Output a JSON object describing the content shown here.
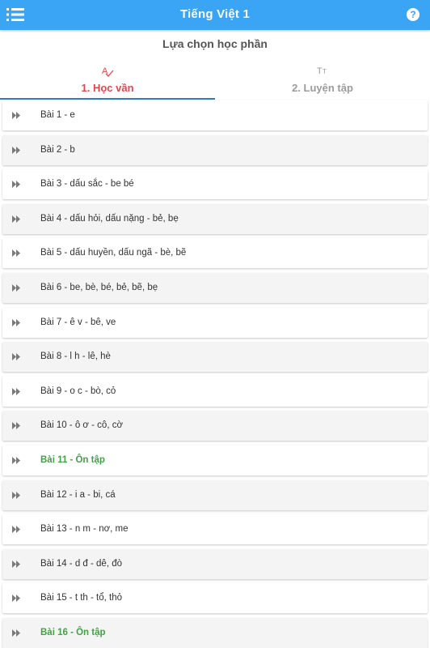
{
  "header": {
    "title": "Tiếng Việt 1",
    "help_label": "?"
  },
  "subtitle": "Lựa chọn học phần",
  "tabs": [
    {
      "label": "1. Học vần",
      "icon": "spell-check-icon",
      "active": true
    },
    {
      "label": "2. Luyện tập",
      "icon": "text-size-icon",
      "active": false
    }
  ],
  "lessons": [
    {
      "label": "Bài 1 - e",
      "review": false
    },
    {
      "label": "Bài 2 - b",
      "review": false
    },
    {
      "label": "Bài 3 - dấu sắc - be bé",
      "review": false
    },
    {
      "label": "Bài 4 - dấu hỏi, dấu nặng - bẻ, bẹ",
      "review": false
    },
    {
      "label": "Bài 5 - dấu huyền, dấu ngã - bè, bẽ",
      "review": false
    },
    {
      "label": "Bài 6 - be, bè, bé, bẻ, bẽ, bẹ",
      "review": false
    },
    {
      "label": "Bài 7 - ê v - bê, ve",
      "review": false
    },
    {
      "label": "Bài 8 - l h - lê, hè",
      "review": false
    },
    {
      "label": "Bài 9 - o c - bò, cỏ",
      "review": false
    },
    {
      "label": "Bài 10 - ô ơ - cô, cờ",
      "review": false
    },
    {
      "label": "Bài 11 - Ôn tập",
      "review": true
    },
    {
      "label": "Bài 12 - i a - bi, cá",
      "review": false
    },
    {
      "label": "Bài 13 - n m - nơ, me",
      "review": false
    },
    {
      "label": "Bài 14 - d đ - dê, đò",
      "review": false
    },
    {
      "label": "Bài 15 - t th - tổ, thỏ",
      "review": false
    },
    {
      "label": "Bài 16 - Ôn tập",
      "review": true
    }
  ],
  "colors": {
    "appbar": "#3aa4f5",
    "active_tab": "#e0474c",
    "inactive_tab": "#9b9b9b",
    "review_text": "#43a047"
  }
}
